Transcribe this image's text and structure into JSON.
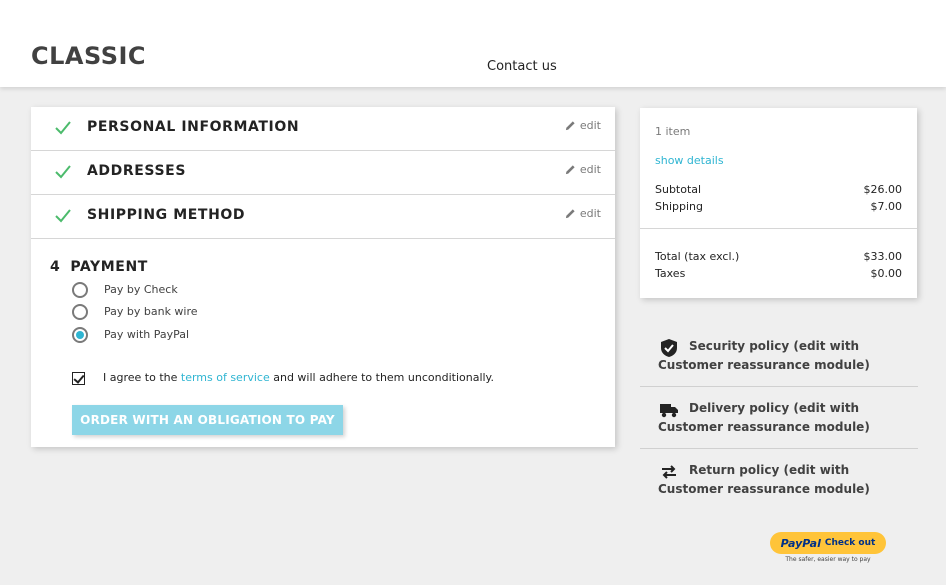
{
  "header": {
    "logo": "CLASSIC",
    "nav_contact": "Contact us"
  },
  "checkout": {
    "steps": [
      {
        "title": "PERSONAL INFORMATION",
        "edit": "edit",
        "complete": true
      },
      {
        "title": "ADDRESSES",
        "edit": "edit",
        "complete": true
      },
      {
        "title": "SHIPPING METHOD",
        "edit": "edit",
        "complete": true
      }
    ],
    "payment": {
      "number": "4",
      "title": "PAYMENT",
      "options": [
        {
          "label": "Pay by Check",
          "selected": false
        },
        {
          "label": "Pay by bank wire",
          "selected": false
        },
        {
          "label": "Pay with PayPal",
          "selected": true
        }
      ],
      "agree_prefix": "I agree to the",
      "agree_link": "terms of service",
      "agree_suffix": "and will adhere to them unconditionally.",
      "agree_checked": true,
      "order_button": "ORDER WITH AN OBLIGATION TO PAY"
    }
  },
  "summary": {
    "item_count": "1 item",
    "show_details": "show details",
    "subtotal_label": "Subtotal",
    "subtotal_value": "$26.00",
    "shipping_label": "Shipping",
    "shipping_value": "$7.00",
    "total_label": "Total (tax excl.)",
    "total_value": "$33.00",
    "taxes_label": "Taxes",
    "taxes_value": "$0.00"
  },
  "reassurance": [
    {
      "icon": "shield-icon",
      "text": "Security policy (edit with Customer reassurance module)"
    },
    {
      "icon": "truck-icon",
      "text": "Delivery policy (edit with Customer reassurance module)"
    },
    {
      "icon": "swap-arrows-icon",
      "text": "Return policy (edit with Customer reassurance module)"
    }
  ],
  "paypal": {
    "brand": "PayPal",
    "button_text": "Check out",
    "tagline": "The safer, easier way to pay"
  },
  "colors": {
    "accent": "#2fb5d2",
    "check_green": "#4cbb6c",
    "button_disabled": "#8dd6e7",
    "paypal_yellow": "#ffc439"
  }
}
